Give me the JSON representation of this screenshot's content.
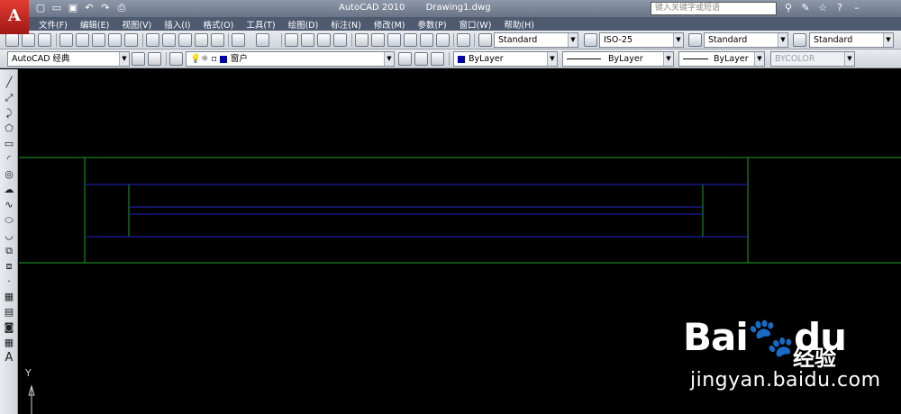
{
  "window": {
    "app_title": "AutoCAD 2010",
    "document_title": "Drawing1.dwg",
    "search_placeholder": "键入关键字或短语",
    "logo_letter": "A"
  },
  "menu": {
    "items": [
      "文件(F)",
      "编辑(E)",
      "视图(V)",
      "插入(I)",
      "格式(O)",
      "工具(T)",
      "绘图(D)",
      "标注(N)",
      "修改(M)",
      "参数(P)",
      "窗口(W)",
      "帮助(H)"
    ]
  },
  "toolbar1": {
    "text_style": "Standard",
    "dim_style": "ISO-25",
    "table_style": "Standard",
    "multileader_style": "Standard"
  },
  "toolbar2": {
    "workspace": "AutoCAD 经典",
    "layer": "窗户",
    "color": "ByLayer",
    "linetype": "ByLayer",
    "lineweight": "ByLayer",
    "plot_style": "BYCOLOR"
  },
  "left_toolbar": {
    "text_tool_label": "A"
  },
  "ucs": {
    "y_label": "Y"
  },
  "watermark": {
    "brand": "Bai",
    "brand_tail": "du",
    "cn": "经验",
    "url": "jingyan.baidu.com"
  },
  "colors": {
    "canvas_bg": "#000000",
    "green_line": "#1fa02a",
    "blue_line": "#2424c8",
    "title_bar": "#7a8497",
    "menu_bar": "#4e5a70"
  }
}
